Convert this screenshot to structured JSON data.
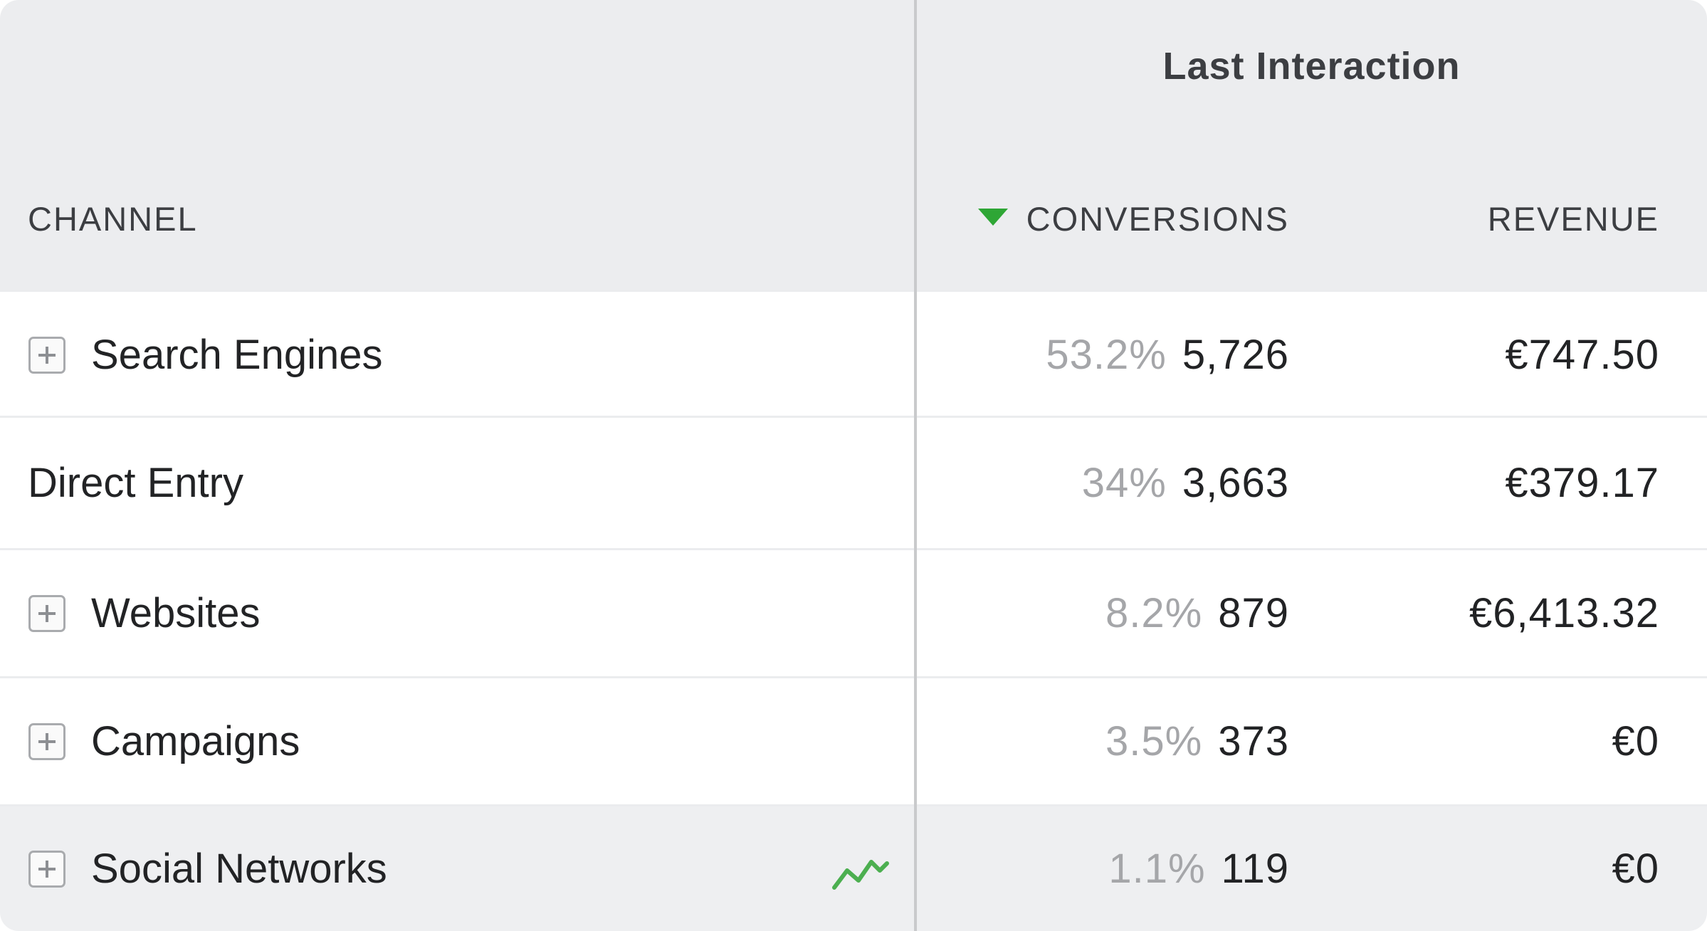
{
  "header": {
    "group_title": "Last Interaction",
    "columns": {
      "channel": "CHANNEL",
      "conversions": "CONVERSIONS",
      "revenue": "REVENUE"
    },
    "sort": {
      "column": "conversions",
      "direction": "descending",
      "icon": "sort-desc-triangle-icon",
      "color": "#2ea635"
    }
  },
  "rows": [
    {
      "channel": "Search Engines",
      "expandable": true,
      "pct": "53.2%",
      "conversions": "5,726",
      "revenue": "€747.50"
    },
    {
      "channel": "Direct Entry",
      "expandable": false,
      "pct": "34%",
      "conversions": "3,663",
      "revenue": "€379.17"
    },
    {
      "channel": "Websites",
      "expandable": true,
      "pct": "8.2%",
      "conversions": "879",
      "revenue": "€6,413.32"
    },
    {
      "channel": "Campaigns",
      "expandable": true,
      "pct": "3.5%",
      "conversions": "373",
      "revenue": "€0"
    },
    {
      "channel": "Social Networks",
      "expandable": true,
      "pct": "1.1%",
      "conversions": "119",
      "revenue": "€0",
      "hovered": true,
      "row_action_icon": "row-evolution-chart-icon"
    }
  ],
  "colors": {
    "header_bg": "#ecedef",
    "hover_row_bg": "#eeeff1",
    "accent_green": "#2ea635",
    "percent_text": "#a5a6a9"
  }
}
